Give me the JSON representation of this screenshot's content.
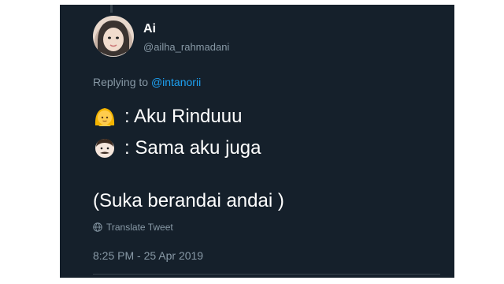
{
  "tweet": {
    "author_name": "Ai",
    "author_handle": "@ailha_rahmadani",
    "replying_prefix": "Replying to ",
    "replying_to": "@intanorii",
    "lines": [
      ": Aku Rinduuu",
      ": Sama aku juga",
      "(Suka berandai andai )"
    ],
    "translate_label": "Translate Tweet",
    "timestamp": "8:25 PM - 25 Apr 2019"
  },
  "icons": {
    "line1_emoji": "girl-face-emoji",
    "line2_emoji": "man-face-emoji",
    "translate": "globe-icon"
  },
  "colors": {
    "background": "#15202b",
    "text": "#ffffff",
    "muted": "#8899a6",
    "link": "#1da1f2"
  }
}
